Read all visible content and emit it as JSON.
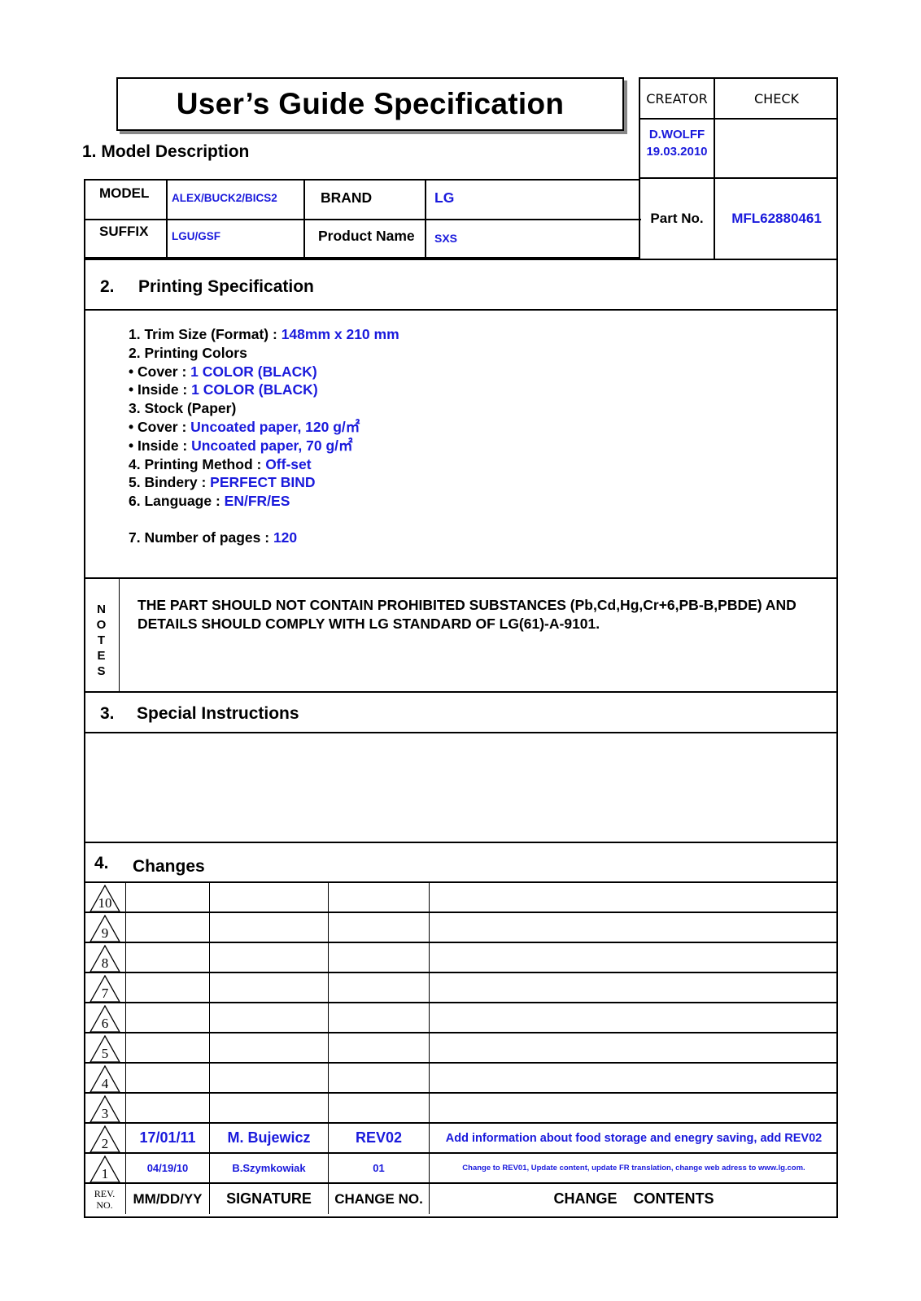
{
  "title": "User’s Guide Specification",
  "approval": {
    "creator_label": "CREATOR",
    "check_label": "CHECK",
    "creator_name": "D.WOLFF",
    "creator_date": "19.03.2010",
    "check_value": "",
    "part_no_label": "Part No.",
    "part_no": "MFL62880461"
  },
  "model_description": {
    "heading": "1. Model Description",
    "model_label": "MODEL",
    "model_value": "ALEX/BUCK2/BICS2",
    "suffix_label": "SUFFIX",
    "suffix_value": "LGU/GSF",
    "brand_label": "BRAND",
    "brand_value": "LG",
    "product_name_label": "Product Name",
    "product_name_value": "SXS"
  },
  "printing_spec": {
    "number": "2.",
    "heading": "Printing Specification",
    "lines": [
      {
        "label": "1. Trim Size (Format) : ",
        "value": "148mm x 210 mm"
      },
      {
        "label": "2. Printing Colors",
        "value": ""
      },
      {
        "label": "• Cover : ",
        "value": "1 COLOR (BLACK)"
      },
      {
        "label": "• Inside : ",
        "value": "1 COLOR (BLACK)"
      },
      {
        "label": "3. Stock (Paper)",
        "value": ""
      },
      {
        "label": "• Cover : ",
        "value": "Uncoated paper,  120 g/㎡"
      },
      {
        "label": "• Inside : ",
        "value": "Uncoated paper,  70 g/㎡"
      },
      {
        "label": "4. Printing Method : ",
        "value": "Off-set"
      },
      {
        "label": "5. Bindery  : ",
        "value": "PERFECT BIND"
      },
      {
        "label": "6. Language : ",
        "value": "EN/FR/ES"
      },
      {
        "label": "7. Number of pages : ",
        "value": "120"
      }
    ]
  },
  "notes": {
    "vertical_label": [
      "N",
      "O",
      "T",
      "E",
      "S"
    ],
    "text": "THE PART SHOULD NOT CONTAIN PROHIBITED SUBSTANCES (Pb,Cd,Hg,Cr+6,PB-B,PBDE) AND DETAILS SHOULD COMPLY WITH LG STANDARD OF LG(61)-A-9101."
  },
  "special_instructions": {
    "number": "3.",
    "heading": "Special Instructions",
    "text": ""
  },
  "changes": {
    "number": "4.",
    "heading": "Changes",
    "rows": [
      {
        "rev": "10",
        "date": "",
        "signature": "",
        "change_no": "",
        "contents": ""
      },
      {
        "rev": "9",
        "date": "",
        "signature": "",
        "change_no": "",
        "contents": ""
      },
      {
        "rev": "8",
        "date": "",
        "signature": "",
        "change_no": "",
        "contents": ""
      },
      {
        "rev": "7",
        "date": "",
        "signature": "",
        "change_no": "",
        "contents": ""
      },
      {
        "rev": "6",
        "date": "",
        "signature": "",
        "change_no": "",
        "contents": ""
      },
      {
        "rev": "5",
        "date": "",
        "signature": "",
        "change_no": "",
        "contents": ""
      },
      {
        "rev": "4",
        "date": "",
        "signature": "",
        "change_no": "",
        "contents": ""
      },
      {
        "rev": "3",
        "date": "",
        "signature": "",
        "change_no": "",
        "contents": ""
      },
      {
        "rev": "2",
        "date": "17/01/11",
        "signature": "M. Bujewicz",
        "change_no": "REV02",
        "contents": "Add information about food storage and enegry saving, add REV02"
      },
      {
        "rev": "1",
        "date": "04/19/10",
        "signature": "B.Szymkowiak",
        "change_no": "01",
        "contents": "Change to REV01, Update content, update FR translation, change web adress to www.lg.com."
      }
    ],
    "footer": {
      "rev_no_label_1": "REV.",
      "rev_no_label_2": "NO.",
      "date_label": "MM/DD/YY",
      "signature_label": "SIGNATURE",
      "change_no_label": "CHANGE NO.",
      "contents_label": "CHANGE    CONTENTS"
    }
  },
  "colors": {
    "value_blue": "#1a1adc",
    "line": "#000000",
    "title_shadow": "#888888"
  }
}
